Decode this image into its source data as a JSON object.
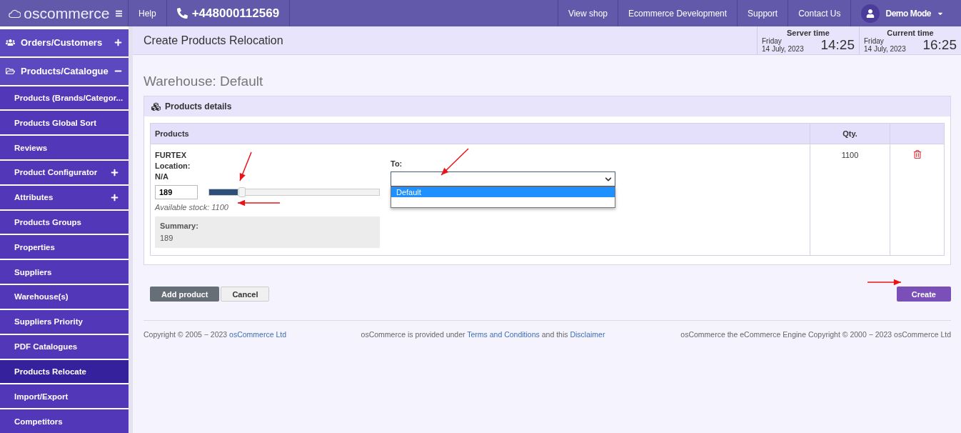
{
  "topbar": {
    "logo": "oscommerce",
    "help": "Help",
    "phone": "+448000112569",
    "links": [
      "View shop",
      "Ecommerce Development",
      "Support",
      "Contact Us"
    ],
    "user": "Demo Mode"
  },
  "sidebar": {
    "items": [
      {
        "label": "Orders/Customers",
        "kind": "group",
        "expanded": false,
        "selected": false
      },
      {
        "label": "Products/Catalogue",
        "kind": "group",
        "expanded": true,
        "selected": false
      },
      {
        "label": "Products (Brands/Categor...",
        "kind": "item",
        "selected": false
      },
      {
        "label": "Products Global Sort",
        "kind": "item",
        "selected": false
      },
      {
        "label": "Reviews",
        "kind": "item",
        "selected": false
      },
      {
        "label": "Product Configurator",
        "kind": "expandable",
        "expanded": false,
        "selected": false
      },
      {
        "label": "Attributes",
        "kind": "expandable",
        "expanded": false,
        "selected": false
      },
      {
        "label": "Products Groups",
        "kind": "item",
        "selected": false
      },
      {
        "label": "Properties",
        "kind": "item",
        "selected": false
      },
      {
        "label": "Suppliers",
        "kind": "item",
        "selected": false
      },
      {
        "label": "Warehouse(s)",
        "kind": "item",
        "selected": false
      },
      {
        "label": "Suppliers Priority",
        "kind": "item",
        "selected": false
      },
      {
        "label": "PDF Catalogues",
        "kind": "item",
        "selected": false
      },
      {
        "label": "Products Relocate",
        "kind": "item",
        "selected": true
      },
      {
        "label": "Import/Export",
        "kind": "item",
        "selected": false
      },
      {
        "label": "Competitors",
        "kind": "item",
        "selected": false
      }
    ]
  },
  "header": {
    "title": "Create Products Relocation",
    "clocks": [
      {
        "label": "Server time",
        "day": "Friday",
        "date": "14 July, 2023",
        "time": "14:25"
      },
      {
        "label": "Current time",
        "day": "Friday",
        "date": "14 July, 2023",
        "time": "16:25"
      }
    ]
  },
  "warehouse_title": "Warehouse: Default",
  "panel": {
    "title": "Products details",
    "columns": [
      "Products",
      "Qty."
    ],
    "rows": [
      {
        "name": "FURTEX",
        "location_label": "Location:",
        "location": "N/A",
        "quantity": "189",
        "slider": {
          "level": 0.17
        },
        "available": "Available stock: 1100",
        "summary_label": "Summary:",
        "summary": "189",
        "to_label": "To:",
        "to_value": "",
        "dropdown_open": true,
        "options": [
          {
            "label": "Default",
            "selected": true
          }
        ],
        "qty": "1100"
      }
    ]
  },
  "buttons": {
    "add": "Add product",
    "cancel": "Cancel",
    "create": "Create"
  },
  "footer": {
    "left": "Copyright © 2005 − 2023 ",
    "left_link": "osCommerce Ltd",
    "middle_pre": "osCommerce is provided under ",
    "middle_link1": "Terms and Conditions",
    "middle_mid": " and this ",
    "middle_link2": "Disclaimer",
    "right": "osCommerce the eCommerce Engine Copyright © 2000 − 2023 osCommerce Ltd"
  }
}
